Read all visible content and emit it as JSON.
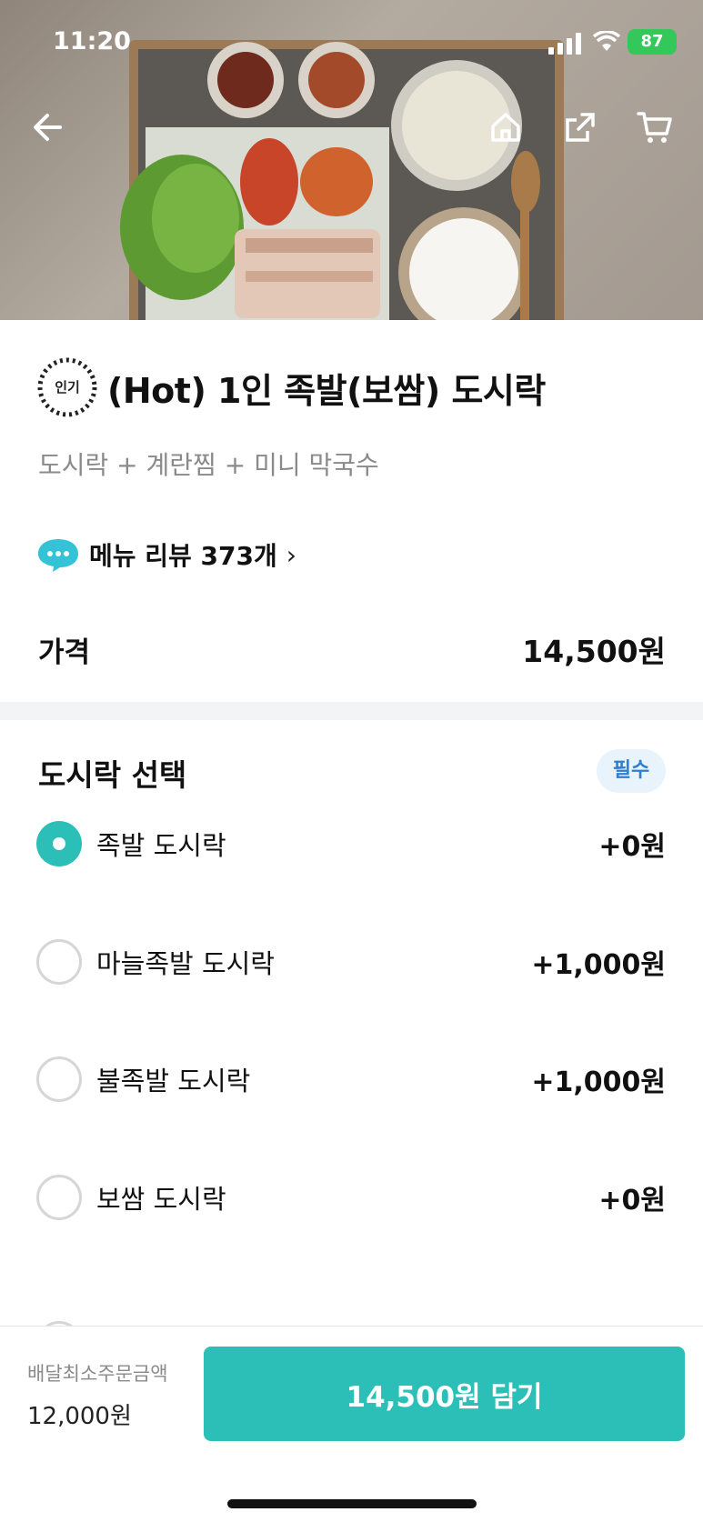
{
  "status_bar": {
    "time": "11:20",
    "battery": "87"
  },
  "header": {
    "icons": [
      "back-arrow-icon",
      "home-icon",
      "share-icon",
      "cart-icon"
    ]
  },
  "product": {
    "badge": "인기",
    "title": "(Hot) 1인 족발(보쌈) 도시락",
    "description": "도시락 + 계란찜 + 미니 막국수",
    "reviews": "메뉴 리뷰 373개",
    "price_label": "가격",
    "price": "14,500원"
  },
  "option_group": {
    "title": "도시락 선택",
    "required": "필수",
    "selected_index": 0,
    "options": [
      {
        "name": "족발 도시락",
        "extra": "+0원"
      },
      {
        "name": "마늘족발 도시락",
        "extra": "+1,000원"
      },
      {
        "name": "불족발 도시락",
        "extra": "+1,000원"
      },
      {
        "name": "보쌈 도시락",
        "extra": "+0원"
      }
    ]
  },
  "footer": {
    "min_order_label": "배달최소주문금액",
    "min_order_value": "12,000원",
    "add_button": "14,500원 담기"
  },
  "colors": {
    "accent": "#2cbfb8",
    "required_text": "#2f7fd0",
    "required_bg": "#e8f3fb"
  }
}
